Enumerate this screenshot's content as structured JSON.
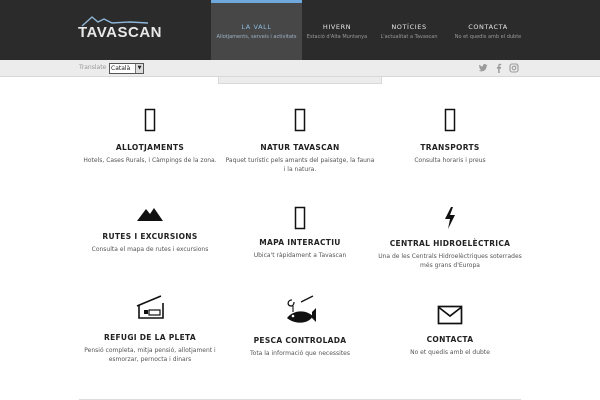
{
  "brand": {
    "name": "TAVASCAN"
  },
  "nav": [
    {
      "title": "LA VALL",
      "subtitle": "Allotjaments, serveis i activitats"
    },
    {
      "title": "HIVERN",
      "subtitle": "Estació d'Alta Muntanya"
    },
    {
      "title": "NOTÍCIES",
      "subtitle": "L'actualitat a Tavascan"
    },
    {
      "title": "CONTACTA",
      "subtitle": "No et quedis amb el dubte"
    }
  ],
  "toolbar": {
    "translate_label": "Translate",
    "language": "Català",
    "social": [
      "twitter-icon",
      "facebook-icon",
      "instagram-icon"
    ]
  },
  "cards": [
    {
      "icon": "bed-icon",
      "title": "ALLOTJAMENTS",
      "desc": "Hotels, Cases Rurals, i Càmpings de la zona."
    },
    {
      "icon": "tree-icon",
      "title": "NATUR TAVASCAN",
      "desc": "Paquet turístic pels amants del paisatge, la fauna i la natura."
    },
    {
      "icon": "bus-icon",
      "title": "TRANSPORTS",
      "desc": "Consulta horaris i preus"
    },
    {
      "icon": "mountain-icon",
      "title": "RUTES I EXCURSIONS",
      "desc": "Consulta el mapa de rutes i excursions"
    },
    {
      "icon": "map-icon",
      "title": "MAPA INTERACTIU",
      "desc": "Ubica't ràpidament a Tavascan"
    },
    {
      "icon": "lightning-icon",
      "title": "CENTRAL HIDROELÈCTRICA",
      "desc": "Una de les Centrals Hidroelèctriques soterrades més grans d'Europa"
    },
    {
      "icon": "refuge-icon",
      "title": "REFUGI DE LA PLETA",
      "desc": "Pensió completa, mitja pensió, allotjament i esmorzar, pernocta i dinars"
    },
    {
      "icon": "fish-hook-icon",
      "title": "PESCA CONTROLADA",
      "desc": "Tota la informació que necessites"
    },
    {
      "icon": "envelope-icon",
      "title": "CONTACTA",
      "desc": "No et quedis amb el dubte"
    }
  ]
}
